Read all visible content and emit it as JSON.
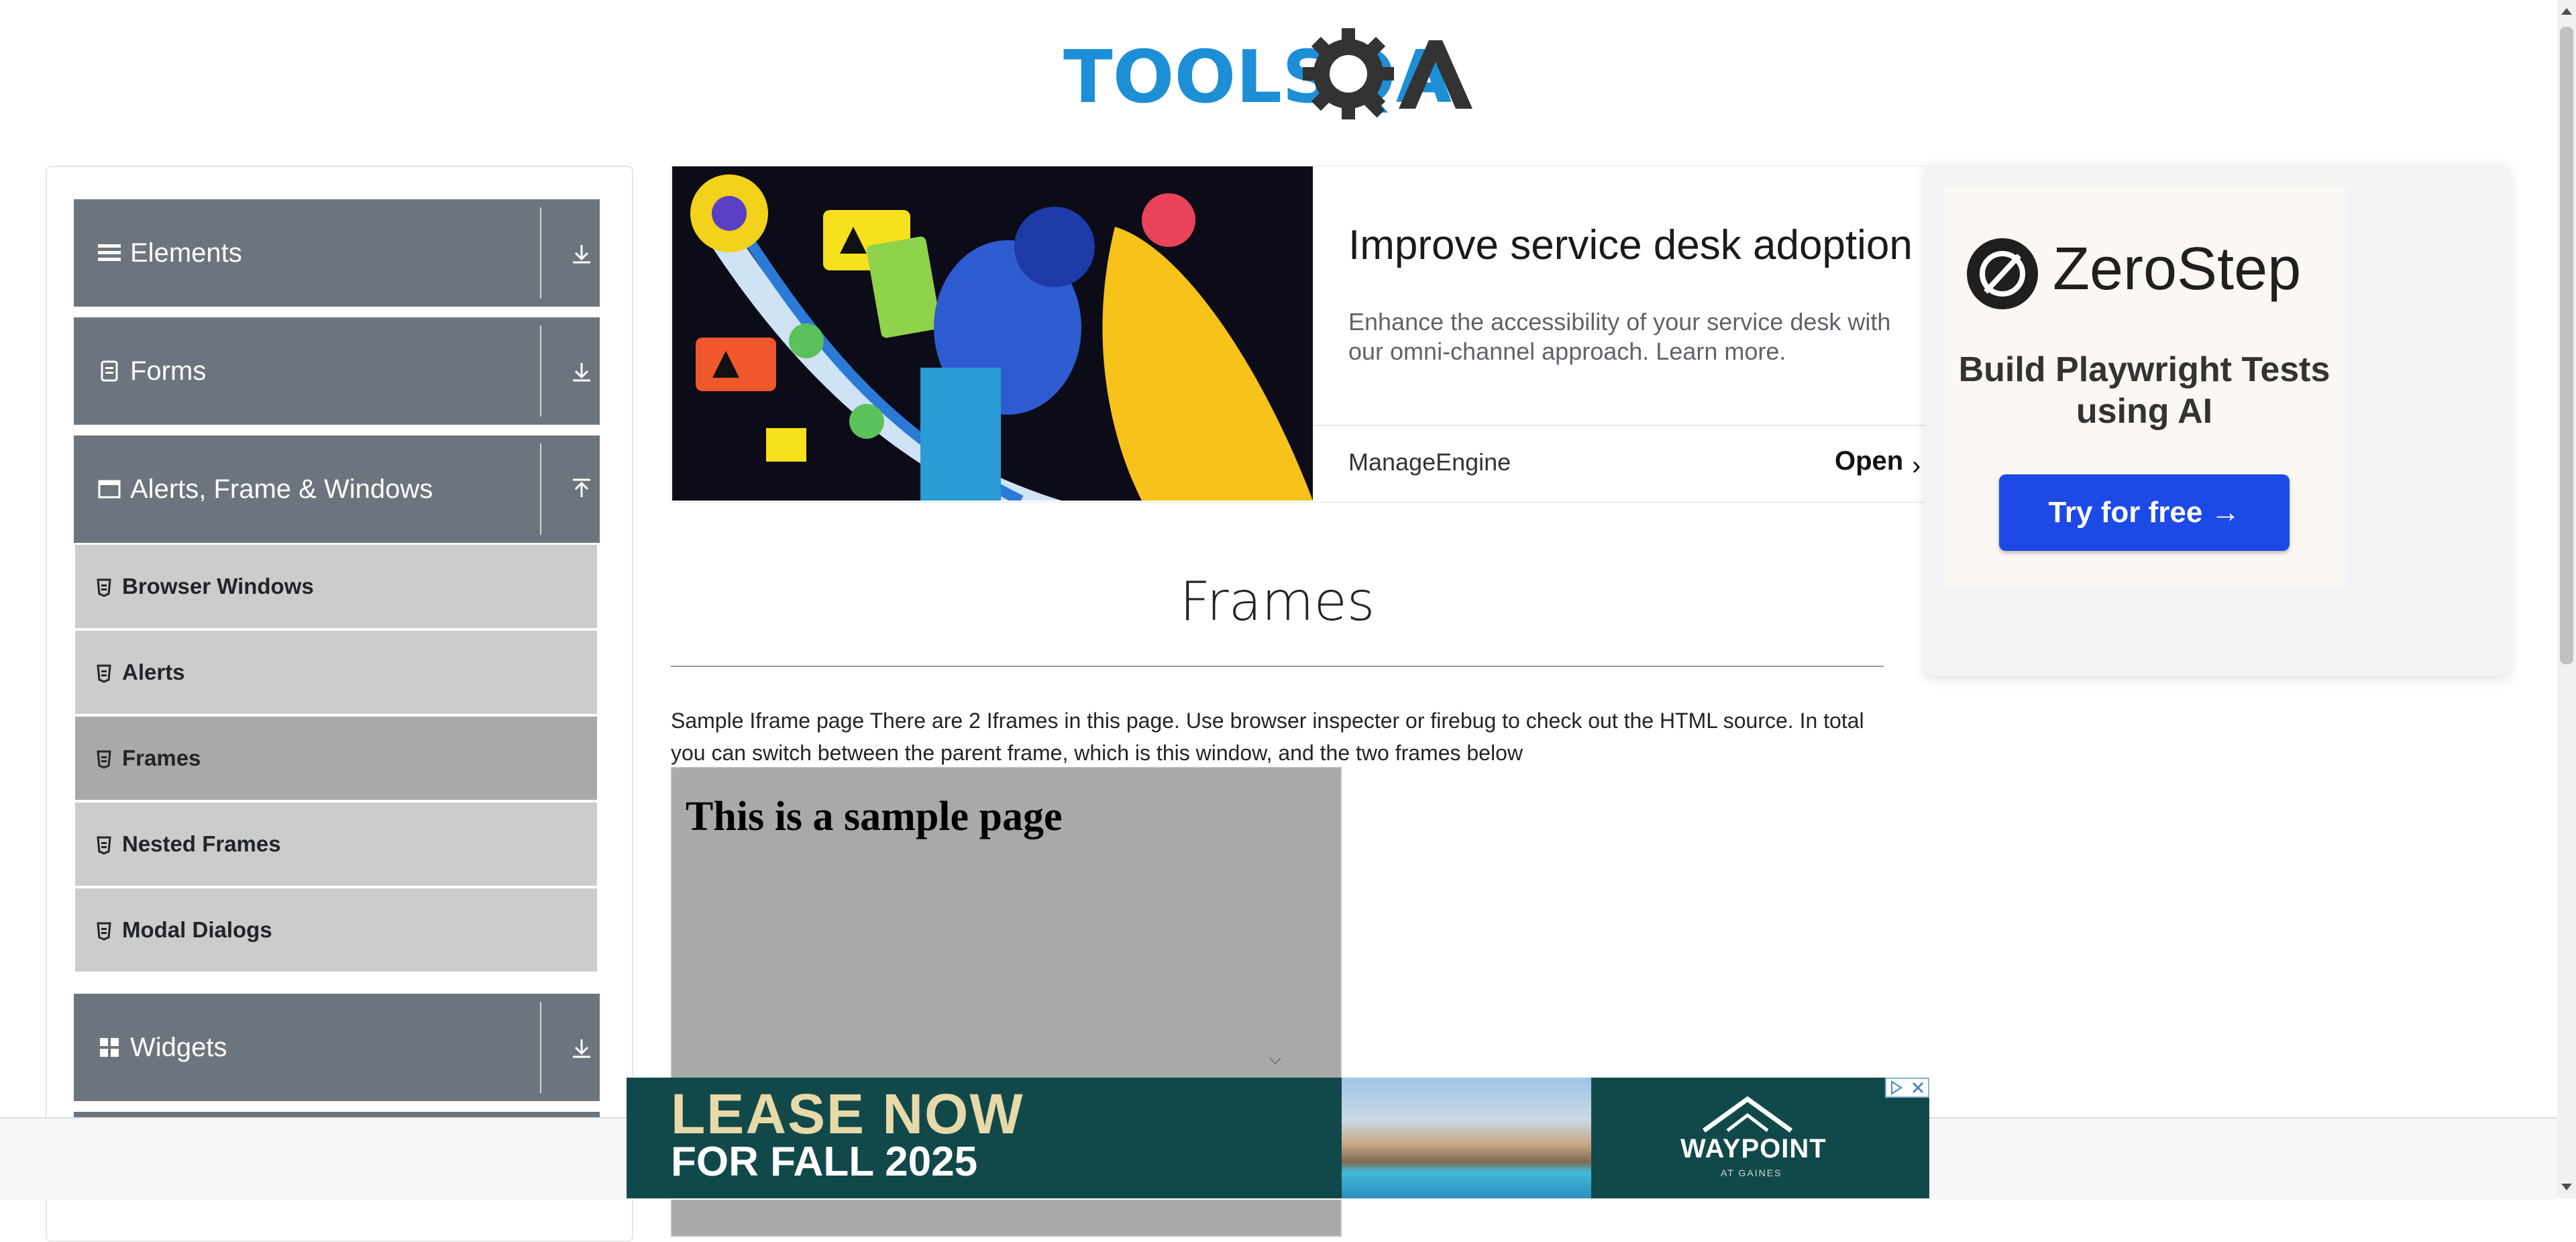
{
  "header": {
    "logo_text": "TOOLSQA"
  },
  "sidebar": {
    "groups": [
      {
        "label": "Elements",
        "icon": "hamburger-icon",
        "expanded": false
      },
      {
        "label": "Forms",
        "icon": "form-doc-icon",
        "expanded": false
      },
      {
        "label": "Alerts, Frame & Windows",
        "icon": "window-icon",
        "expanded": true
      },
      {
        "label": "Widgets",
        "icon": "widgets-grid-icon",
        "expanded": false
      }
    ],
    "alerts_items": [
      {
        "label": "Browser Windows"
      },
      {
        "label": "Alerts"
      },
      {
        "label": "Frames",
        "active": true
      },
      {
        "label": "Nested Frames"
      },
      {
        "label": "Modal Dialogs"
      }
    ]
  },
  "ad_top": {
    "title": "Improve service desk adoption",
    "description": "Enhance the accessibility of your service desk with our omni-channel approach. Learn more.",
    "brand": "ManageEngine",
    "cta": "Open"
  },
  "ad_right": {
    "brand": "ZeroStep",
    "tagline": "Build Playwright Tests using AI",
    "button": "Try for free →"
  },
  "main": {
    "title": "Frames",
    "description": "Sample Iframe page There are 2 Iframes in this page. Use browser inspecter or firebug to check out the HTML source. In total you can switch between the parent frame, which is this window, and the two frames below",
    "iframe_heading": "This is a sample page"
  },
  "ad_bottom": {
    "line1": "LEASE NOW",
    "line2": "FOR FALL 2025",
    "brand": "WAYPOINT",
    "brand_sub": "AT GAINES"
  },
  "colors": {
    "logo_blue": "#1c8fd6",
    "sidebar_header": "#6c757d",
    "menu_item": "#cccccc",
    "menu_item_active": "#a9a9a9",
    "cta_blue": "#1d4ae6",
    "bottom_ad_teal": "#11494a"
  }
}
